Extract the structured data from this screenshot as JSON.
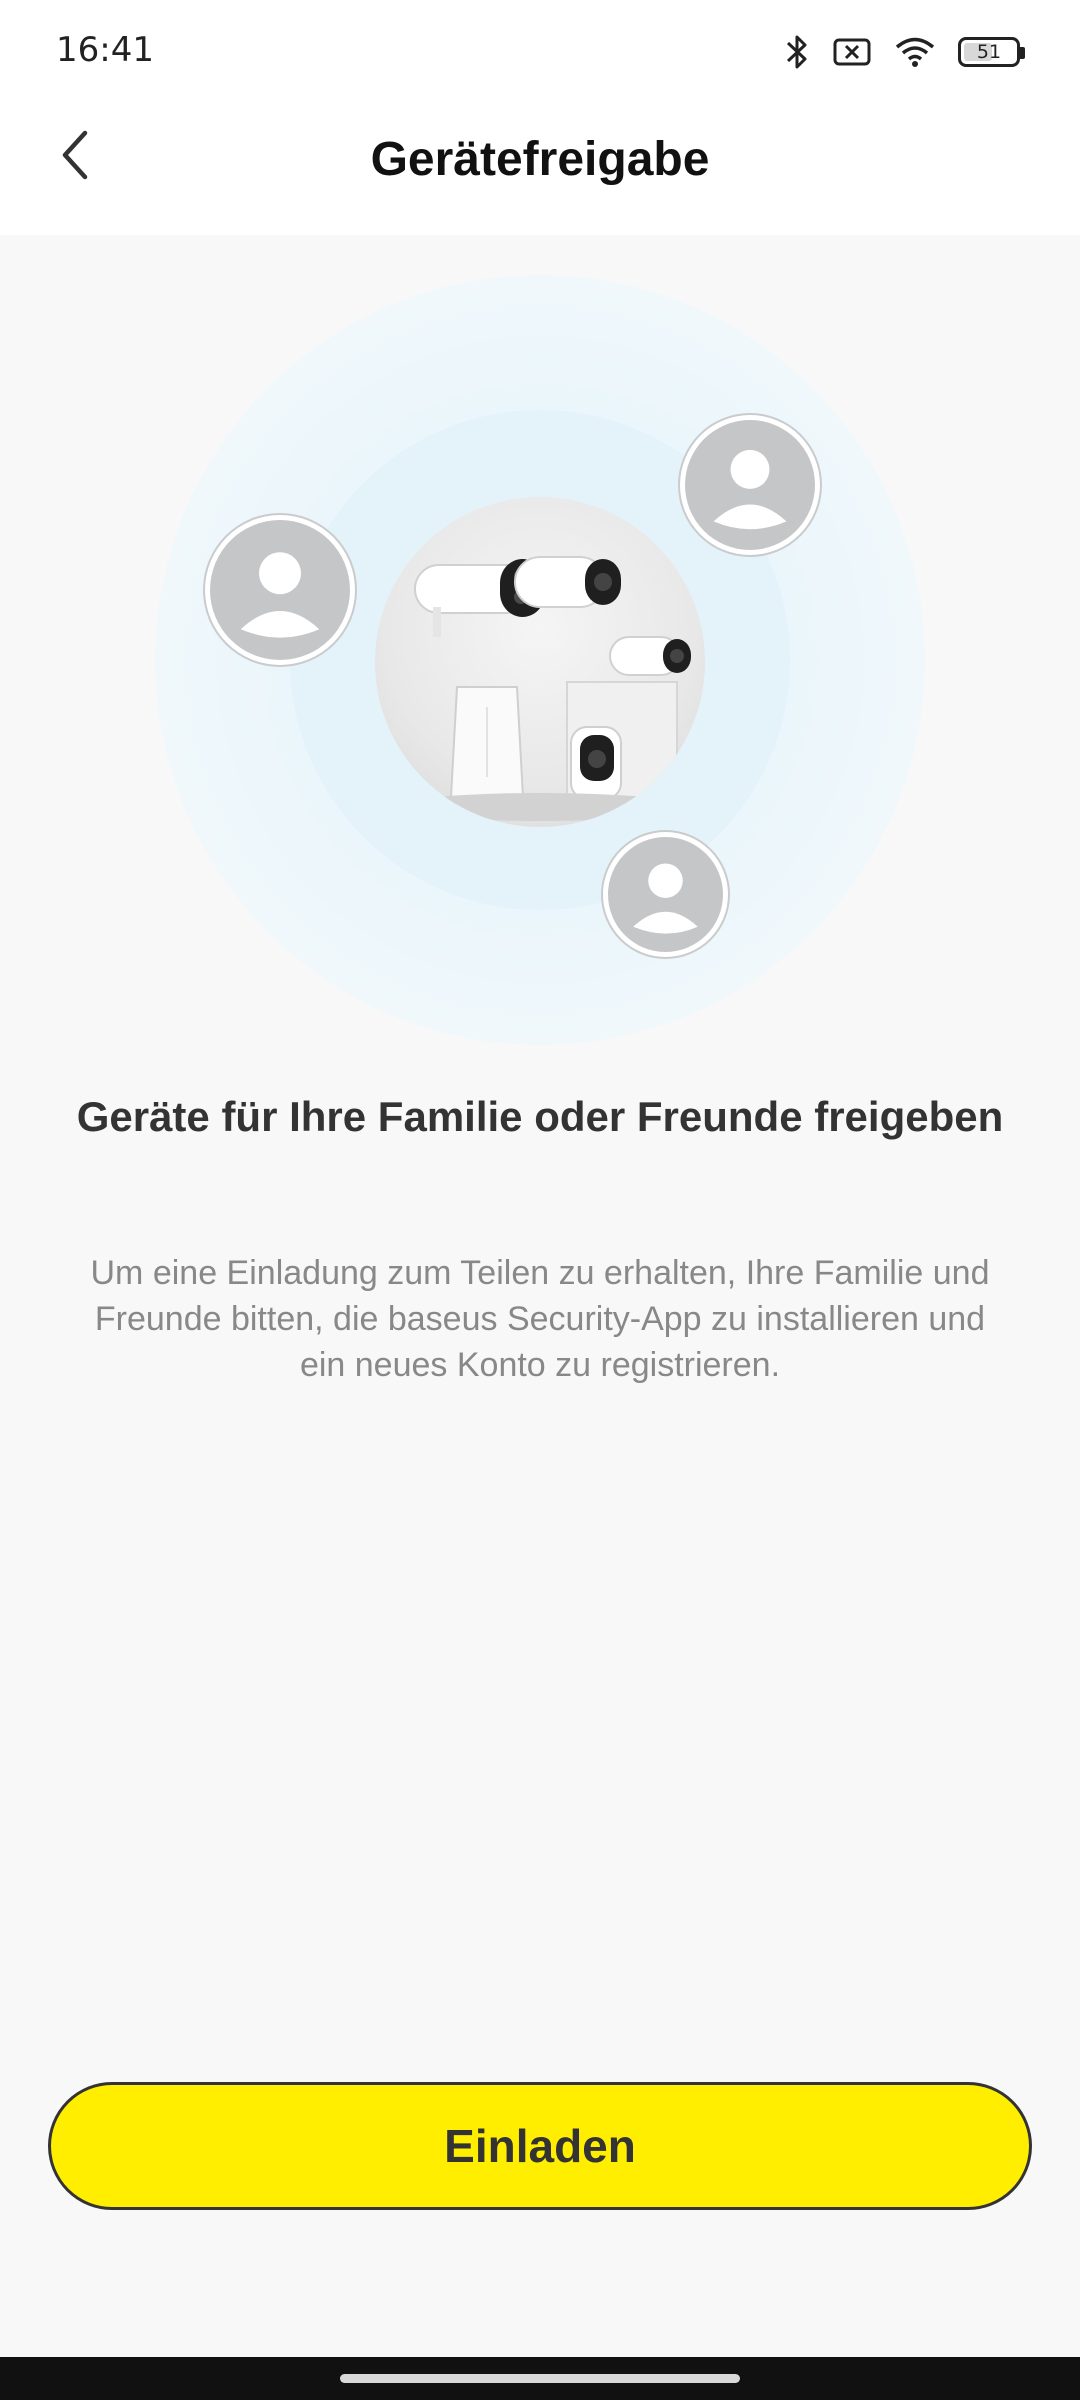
{
  "status_bar": {
    "time": "16:41",
    "battery_level": "51",
    "icons": [
      "bluetooth-icon",
      "no-sim-icon",
      "wifi-icon",
      "battery-icon"
    ]
  },
  "header": {
    "title": "Gerätefreigabe",
    "back_icon": "chevron-left-icon"
  },
  "hero": {
    "image": "security-cameras-illustration",
    "avatars": [
      "user-avatar-icon",
      "user-avatar-icon",
      "user-avatar-icon"
    ]
  },
  "content": {
    "headline": "Geräte für Ihre Familie oder Freunde freigeben",
    "description": "Um eine Einladung zum Teilen zu erhalten, Ihre Familie und Freunde bitten, die baseus Security-App zu installieren und ein neues Konto zu registrieren."
  },
  "actions": {
    "invite_label": "Einladen"
  },
  "colors": {
    "accent": "#FFEE00",
    "button_border": "#333333",
    "background": "#F8F8F8"
  }
}
